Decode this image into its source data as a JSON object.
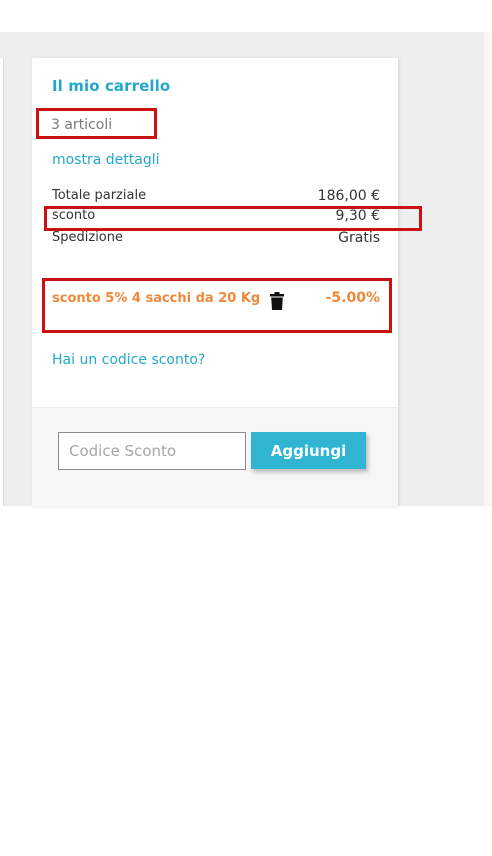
{
  "cart": {
    "title": "Il mio carrello",
    "item_count": "3 articoli",
    "show_details": "mostra dettagli"
  },
  "summary": {
    "subtotal_label": "Totale parziale",
    "subtotal_value": "186,00 €",
    "discount_label": "sconto",
    "discount_value": "9,30 €",
    "shipping_label": "Spedizione",
    "shipping_value": "Gratis"
  },
  "applied_discount": {
    "name": "sconto 5% 4 sacchi da 20 Kg",
    "percent": "-5.00%",
    "remove_icon": "trash-icon"
  },
  "promo": {
    "link_text": "Hai un codice sconto?",
    "input_placeholder": "Codice Sconto",
    "button_label": "Aggiungi"
  },
  "colors": {
    "accent": "#24a8c9",
    "button": "#2fb5d2",
    "discount": "#f0883a",
    "highlight": "#cc1111"
  }
}
